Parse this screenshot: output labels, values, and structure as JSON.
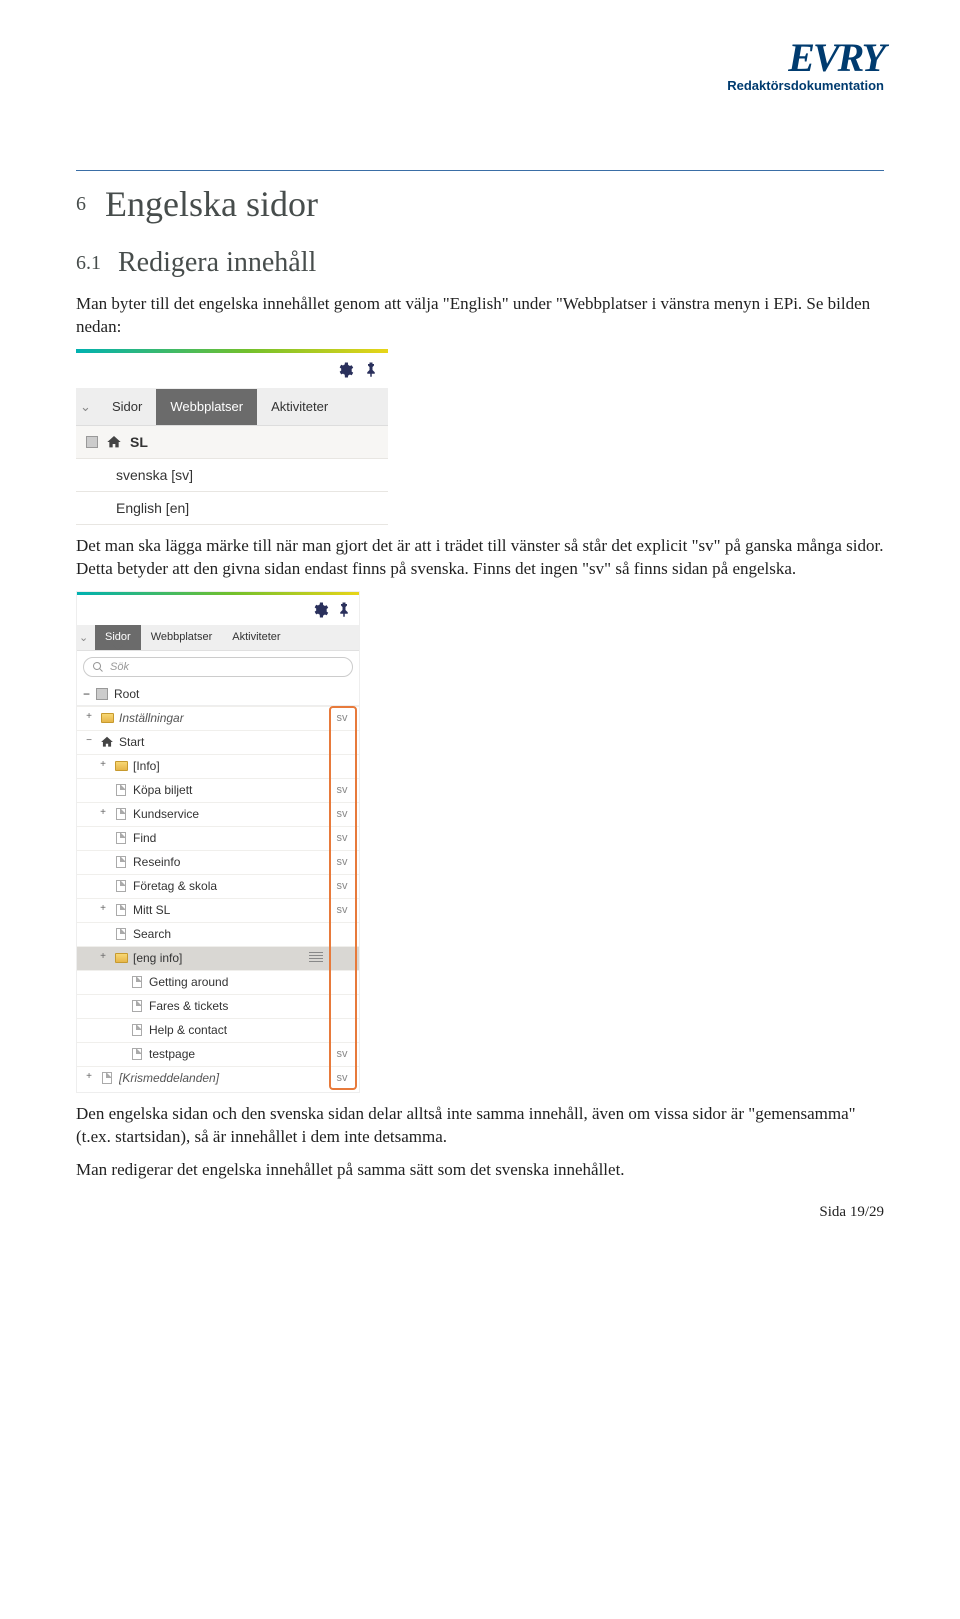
{
  "header": {
    "logo_text": "EVRY",
    "subtitle": "Redaktörsdokumentation"
  },
  "section": {
    "number": "6",
    "title": "Engelska sidor",
    "sub_number": "6.1",
    "sub_title": "Redigera innehåll"
  },
  "paragraphs": {
    "p1": "Man byter till det engelska innehållet genom att välja \"English\" under \"Webbplatser i vänstra menyn i EPi. Se bilden nedan:",
    "p2": "Det man ska lägga märke till när man gjort det är att i trädet till vänster så står det explicit \"sv\" på ganska många sidor. Detta betyder att den givna sidan endast finns på svenska. Finns det ingen \"sv\" så finns sidan på engelska.",
    "p3": "Den engelska sidan och den svenska sidan delar alltså inte samma innehåll, även om vissa sidor är \"gemensamma\"(t.ex. startsidan), så är innehållet i dem inte detsamma.",
    "p4": "Man redigerar det engelska innehållet på samma sätt som det svenska innehållet."
  },
  "shot1": {
    "tabs": {
      "collapse": "⌄",
      "sidor": "Sidor",
      "webbplatser": "Webbplatser",
      "aktiviteter": "Aktiviteter"
    },
    "root": "SL",
    "langs": {
      "sv": "svenska [sv]",
      "en": "English [en]"
    }
  },
  "shot2": {
    "tabs": {
      "collapse": "⌄",
      "sidor": "Sidor",
      "webbplatser": "Webbplatser",
      "aktiviteter": "Aktiviteter"
    },
    "search_placeholder": "Sök",
    "root": "Root",
    "tree": [
      {
        "depth": 0,
        "exp": "+",
        "icon": "folder",
        "label": "Inställningar",
        "lang": "sv",
        "italic": true
      },
      {
        "depth": 0,
        "exp": "−",
        "icon": "home",
        "label": "Start",
        "lang": ""
      },
      {
        "depth": 1,
        "exp": "+",
        "icon": "folder",
        "label": "[Info]",
        "lang": ""
      },
      {
        "depth": 1,
        "exp": "",
        "icon": "page",
        "label": "Köpa biljett",
        "lang": "sv"
      },
      {
        "depth": 1,
        "exp": "+",
        "icon": "page",
        "label": "Kundservice",
        "lang": "sv"
      },
      {
        "depth": 1,
        "exp": "",
        "icon": "page",
        "label": "Find",
        "lang": "sv"
      },
      {
        "depth": 1,
        "exp": "",
        "icon": "page",
        "label": "Reseinfo",
        "lang": "sv"
      },
      {
        "depth": 1,
        "exp": "",
        "icon": "page",
        "label": "Företag & skola",
        "lang": "sv"
      },
      {
        "depth": 1,
        "exp": "+",
        "icon": "page",
        "label": "Mitt SL",
        "lang": "sv"
      },
      {
        "depth": 1,
        "exp": "",
        "icon": "page",
        "label": "Search",
        "lang": ""
      },
      {
        "depth": 1,
        "exp": "+",
        "icon": "folder",
        "label": "[eng info]",
        "lang": "",
        "selected": true
      },
      {
        "depth": 2,
        "exp": "",
        "icon": "page",
        "label": "Getting around",
        "lang": ""
      },
      {
        "depth": 2,
        "exp": "",
        "icon": "page",
        "label": "Fares & tickets",
        "lang": ""
      },
      {
        "depth": 2,
        "exp": "",
        "icon": "page",
        "label": "Help & contact",
        "lang": ""
      },
      {
        "depth": 2,
        "exp": "",
        "icon": "page",
        "label": "testpage",
        "lang": "sv"
      },
      {
        "depth": 0,
        "exp": "+",
        "icon": "page",
        "label": "[Krismeddelanden]",
        "lang": "sv",
        "italic": true
      }
    ]
  },
  "footer": {
    "text": "Sida 19/29"
  }
}
